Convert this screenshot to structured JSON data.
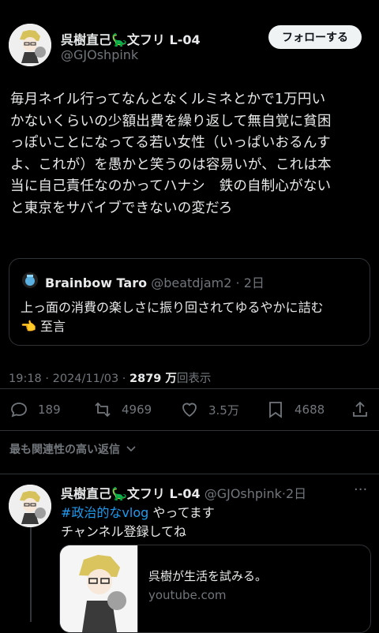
{
  "post": {
    "author_name": "呉樹直己🦕文フリ L-04",
    "author_handle": "@GJOshpink",
    "follow_label": "フォローする",
    "body_lines": [
      "毎月ネイル行ってなんとなくルミネとかで1万円い",
      "かないくらいの少額出費を繰り返して無自覚に貧困",
      "っぽいことになってる若い女性（いっぱいおるんす",
      "よ、これが）を愚かと笑うのは容易いが、これは本",
      "当に自己責任なのかってハナシ　鉄の自制心がない",
      "と東京をサバイブできないの変だろ"
    ],
    "quote": {
      "name": "Brainbow Taro",
      "handle": "@beatdjam2",
      "time": "2日",
      "line1": "上っ面の消費の楽しさに振り回されてゆるやかに詰む",
      "line2": "至言",
      "emoji": "👈"
    },
    "meta": {
      "time": "19:18 · 2024/11/03 · ",
      "views": "2879 万",
      "views_label": "回表示"
    },
    "actions": {
      "replies": "189",
      "reposts": "4969",
      "likes": "3.5万",
      "bookmarks": "4688"
    },
    "relevant_label": "最も関連性の高い返信",
    "reply": {
      "author_name": "呉樹直己🦕文フリ L-04",
      "author_handle": "@GJOshpink",
      "time": "2日",
      "hashtag": "#政治的なvlog",
      "line1_rest": " やってます",
      "line2": "チャンネル登録してね",
      "card_title": "呉樹が生活を試みる。",
      "card_domain": "youtube.com"
    }
  },
  "colors": {
    "background": "#000000",
    "text": "#e7e9ea",
    "muted": "#71767b",
    "link": "#1d9bf0",
    "border": "#2f3336"
  }
}
